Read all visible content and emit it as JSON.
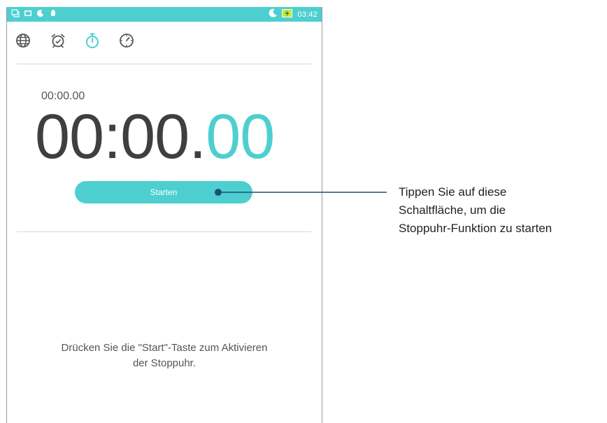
{
  "status_bar": {
    "time": "03:42",
    "left_icons": [
      "notification-icon",
      "gallery-icon",
      "do-not-disturb-icon",
      "android-icon"
    ],
    "right_icons": [
      "night-mode-icon",
      "battery-charging-icon"
    ]
  },
  "tabs": [
    {
      "name": "world-clock",
      "icon": "globe-icon",
      "active": false
    },
    {
      "name": "alarm",
      "icon": "alarm-clock-icon",
      "active": false
    },
    {
      "name": "stopwatch",
      "icon": "stopwatch-icon",
      "active": true
    },
    {
      "name": "timer",
      "icon": "timer-icon",
      "active": false
    }
  ],
  "stopwatch": {
    "lap_time": "00:00.00",
    "main_time": "00:00.",
    "main_hundredths": "00",
    "start_label": "Starten"
  },
  "hint": {
    "line1": "Drücken Sie die \"Start\"-Taste zum Aktivieren",
    "line2": "der Stoppuhr."
  },
  "callout": {
    "line1": "Tippen Sie auf diese",
    "line2": "Schaltfläche, um die",
    "line3": "Stoppuhr-Funktion zu starten"
  },
  "colors": {
    "accent": "#4dcfcf",
    "callout_line": "#1f4e79",
    "text_dark": "#3f3f3f"
  }
}
